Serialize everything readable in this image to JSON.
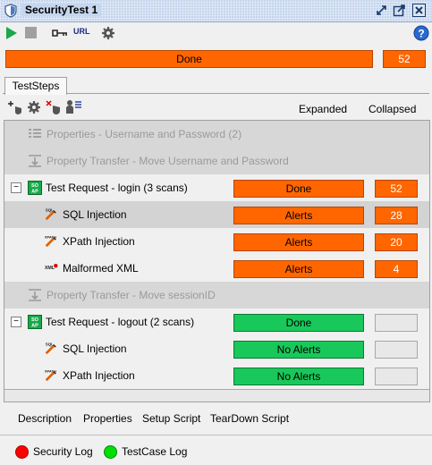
{
  "window": {
    "title": "SecurityTest 1"
  },
  "toolbar": {
    "url_label": "URL"
  },
  "progress": {
    "label": "Done",
    "count": "52",
    "color": "#ff6600"
  },
  "tabs": [
    {
      "label": "TestSteps"
    }
  ],
  "columns": {
    "expanded": "Expanded",
    "collapsed": "Collapsed"
  },
  "rows": [
    {
      "label": "Properties - Username and Password (2)",
      "disabled": true
    },
    {
      "label": "Property Transfer - Move Username and Password",
      "disabled": true
    },
    {
      "label": "Test Request - login (3 scans)",
      "toggle": "−",
      "status": "Done",
      "count": "52",
      "status_color": "#ff6600"
    },
    {
      "label": "SQL Injection",
      "status": "Alerts",
      "count": "28",
      "status_color": "#ff6600"
    },
    {
      "label": "XPath Injection",
      "status": "Alerts",
      "count": "20",
      "status_color": "#ff6600"
    },
    {
      "label": "Malformed XML",
      "status": "Alerts",
      "count": "4",
      "status_color": "#ff6600"
    },
    {
      "label": "Property Transfer - Move sessionID",
      "disabled": true
    },
    {
      "label": "Test Request - logout (2 scans)",
      "toggle": "−",
      "status": "Done",
      "count": "",
      "status_color": "#19c85a"
    },
    {
      "label": "SQL Injection",
      "status": "No Alerts",
      "count": "",
      "status_color": "#19c85a"
    },
    {
      "label": "XPath Injection",
      "status": "No Alerts",
      "count": "",
      "status_color": "#19c85a"
    }
  ],
  "bottom_tabs": [
    {
      "label": "Description"
    },
    {
      "label": "Properties"
    },
    {
      "label": "Setup Script"
    },
    {
      "label": "TearDown Script"
    }
  ],
  "logs": [
    {
      "label": "Security Log",
      "color": "#ff0000"
    },
    {
      "label": "TestCase Log",
      "color": "#00e000"
    }
  ]
}
